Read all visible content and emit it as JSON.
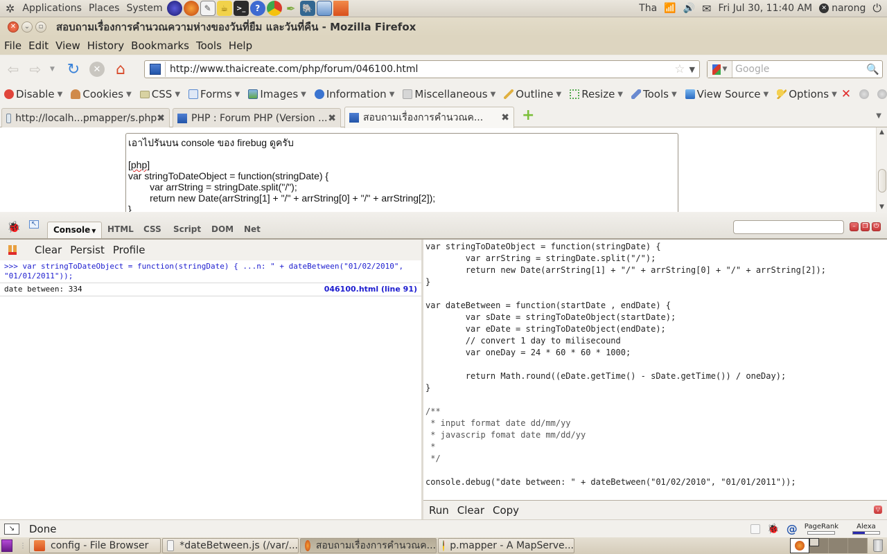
{
  "top_panel": {
    "menus": [
      "Applications",
      "Places",
      "System"
    ],
    "launchers": [
      "eclipse",
      "firefox",
      "text-editor",
      "teapot",
      "terminal",
      "help",
      "chrome",
      "gedit-feather",
      "postgres-elephant",
      "virtualbox",
      "folder"
    ],
    "keyboard_layout": "Tha",
    "clock": "Fri Jul 30, 11:40 AM",
    "user": "narong"
  },
  "window": {
    "title": "สอบถามเรื่องการคำนวณความห่างของวันที่ยืม และวันที่คืน - Mozilla Firefox"
  },
  "menubar": [
    "File",
    "Edit",
    "View",
    "History",
    "Bookmarks",
    "Tools",
    "Help"
  ],
  "navbar": {
    "url": "http://www.thaicreate.com/php/forum/046100.html",
    "search_placeholder": "Google"
  },
  "devtoolbar": {
    "items": [
      {
        "label": "Disable",
        "icon": "disable-icon",
        "color": "#e0453b"
      },
      {
        "label": "Cookies",
        "icon": "cookies-icon",
        "color": "#d08a4a"
      },
      {
        "label": "CSS",
        "icon": "css-icon",
        "color": "#c8c292"
      },
      {
        "label": "Forms",
        "icon": "forms-icon",
        "color": "#5a8ad0"
      },
      {
        "label": "Images",
        "icon": "images-icon",
        "color": "#5fa84a"
      },
      {
        "label": "Information",
        "icon": "information-icon",
        "color": "#3b74d0"
      },
      {
        "label": "Miscellaneous",
        "icon": "miscellaneous-icon",
        "color": "#b8b8b8"
      },
      {
        "label": "Outline",
        "icon": "outline-icon",
        "color": "#e0b040"
      },
      {
        "label": "Resize",
        "icon": "resize-icon",
        "color": "#4fa84a"
      },
      {
        "label": "Tools",
        "icon": "tools-icon",
        "color": "#6a8ad0"
      },
      {
        "label": "View Source",
        "icon": "view-source-icon",
        "color": "#3b84d0"
      },
      {
        "label": "Options",
        "icon": "options-icon",
        "color": "#e0b030"
      }
    ]
  },
  "tabs": [
    {
      "label": "http://localh...pmapper/s.php",
      "active": false
    },
    {
      "label": "PHP : Forum PHP (Version ...",
      "active": false
    },
    {
      "label": "สอบถามเรื่องการคำนวณค...",
      "active": true
    }
  ],
  "page": {
    "post_lines": [
      "เอาไปรันบน console ของ firebug ดูครับ",
      "",
      "[php]",
      "var stringToDateObject = function(stringDate) {",
      "        var arrString = stringDate.split(\"/\");",
      "        return new Date(arrString[1] + \"/\" + arrString[0] + \"/\" + arrString[2]);",
      "}"
    ]
  },
  "firebug": {
    "tabs": [
      "Console",
      "HTML",
      "CSS",
      "Script",
      "DOM",
      "Net"
    ],
    "active_tab": "Console",
    "console_toolbar": [
      "Clear",
      "Persist",
      "Profile"
    ],
    "log": [
      {
        "type": "command",
        "text": ">>> var stringToDateObject = function(stringDate) { ...n: \" + dateBetween(\"01/02/2010\", \"01/01/2011\"));"
      },
      {
        "type": "output",
        "text": "date between: 334",
        "source": "046100.html (line 91)"
      }
    ],
    "editor_lines": [
      "var stringToDateObject = function(stringDate) {",
      "        var arrString = stringDate.split(\"/\");",
      "        return new Date(arrString[1] + \"/\" + arrString[0] + \"/\" + arrString[2]);",
      "}",
      "",
      "var dateBetween = function(startDate , endDate) {",
      "        var sDate = stringToDateObject(startDate);",
      "        var eDate = stringToDateObject(endDate);",
      "        // convert 1 day to milisecound",
      "        var oneDay = 24 * 60 * 60 * 1000;",
      "",
      "        return Math.round((eDate.getTime() - sDate.getTime()) / oneDay);",
      "}",
      "",
      "/**",
      " * input format date dd/mm/yy",
      " * javascrip fomat date mm/dd/yy",
      " *",
      " */",
      "",
      "console.debug(\"date between: \" + dateBetween(\"01/02/2010\", \"01/01/2011\"));"
    ],
    "editor_buttons": [
      "Run",
      "Clear",
      "Copy"
    ]
  },
  "statusbar": {
    "text": "Done",
    "pagerank_label": "PageRank",
    "pagerank_value": 0,
    "alexa_label": "Alexa",
    "alexa_value": 0.45
  },
  "taskbar": {
    "tasks": [
      {
        "label": "config - File Browser",
        "icon": "folder-icon",
        "active": false
      },
      {
        "label": "*dateBetween.js (/var/...",
        "icon": "text-editor-icon",
        "active": false
      },
      {
        "label": "สอบถามเรื่องการคำนวณค...",
        "icon": "firefox-icon",
        "active": true
      },
      {
        "label": "p.mapper - A MapServe...",
        "icon": "chrome-icon",
        "active": false
      }
    ]
  }
}
